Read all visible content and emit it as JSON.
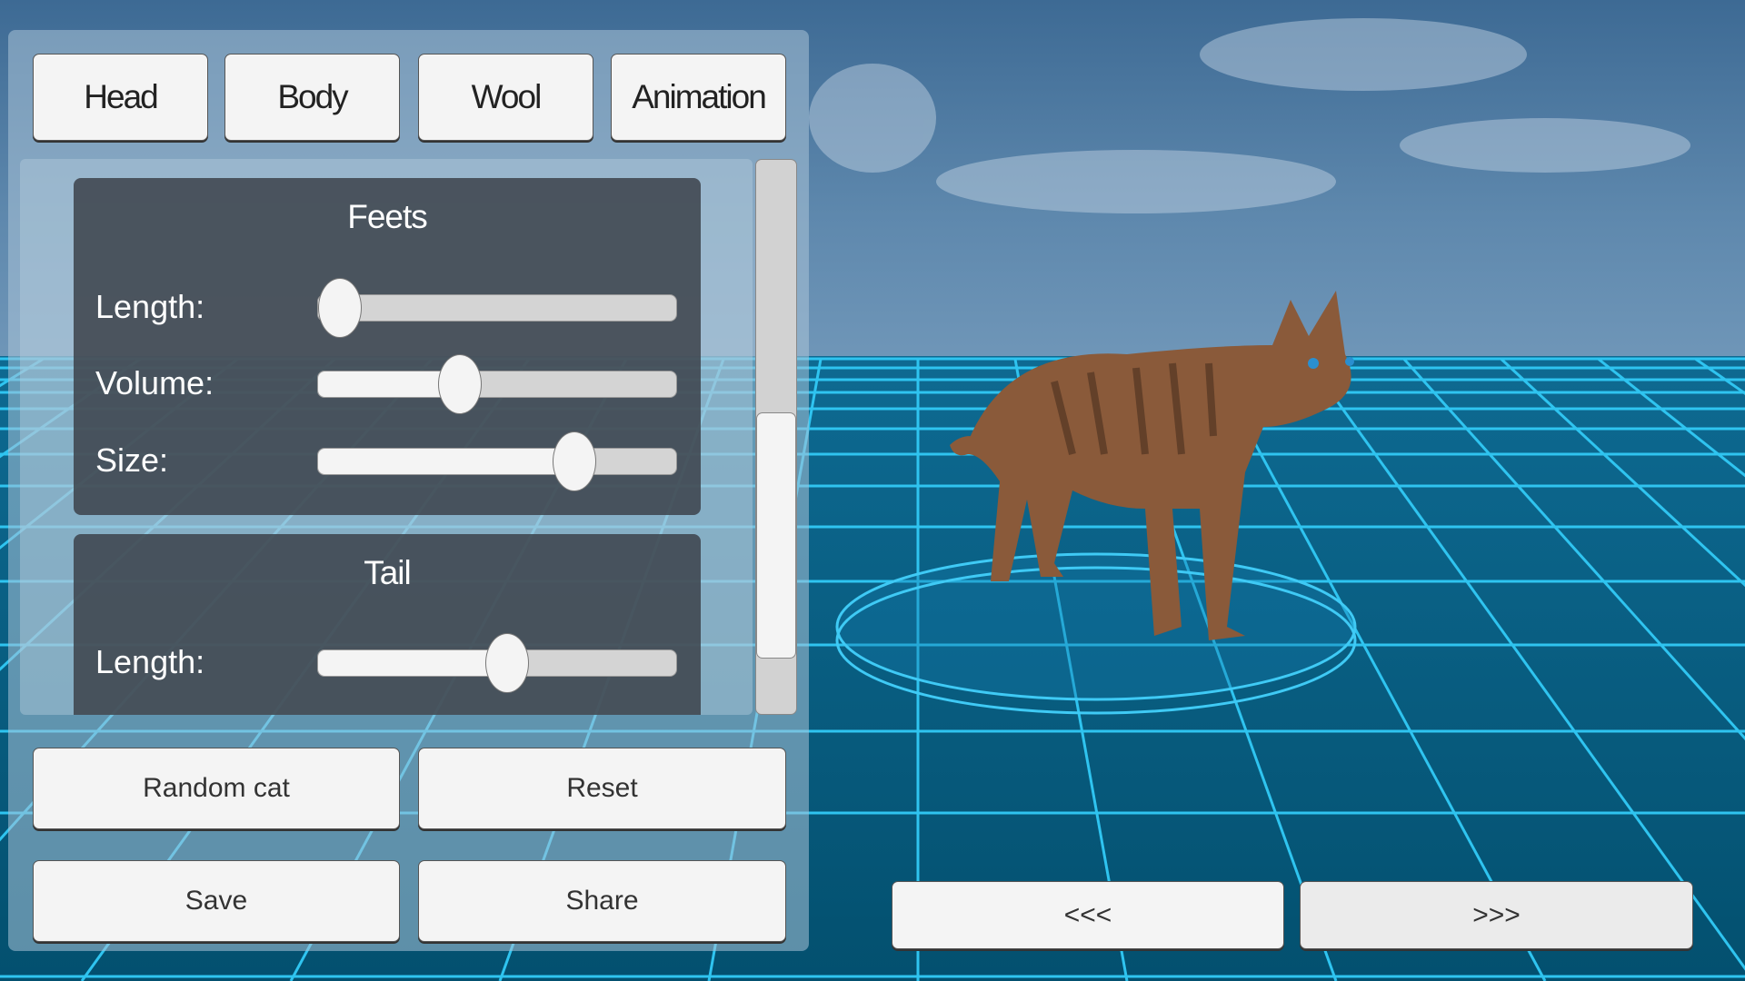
{
  "tabs": [
    {
      "label": "Head"
    },
    {
      "label": "Body"
    },
    {
      "label": "Wool"
    },
    {
      "label": "Animation"
    }
  ],
  "sections": {
    "feets": {
      "title": "Feets",
      "sliders": [
        {
          "label": "Length:",
          "value": 0.0
        },
        {
          "label": "Volume:",
          "value": 0.38
        },
        {
          "label": "Size:",
          "value": 0.74
        }
      ]
    },
    "tail": {
      "title": "Tail",
      "sliders": [
        {
          "label": "Length:",
          "value": 0.53
        }
      ]
    }
  },
  "scrollbar": {
    "position": 0.55
  },
  "actions": {
    "random": "Random cat",
    "reset": "Reset",
    "save": "Save",
    "share": "Share"
  },
  "nav": {
    "prev": "<<<",
    "next": ">>>"
  },
  "colors": {
    "sky": "#3f6f98",
    "floor": "#0a5a80",
    "grid": "#2fc4f0",
    "cat": "#8a5a3a"
  }
}
